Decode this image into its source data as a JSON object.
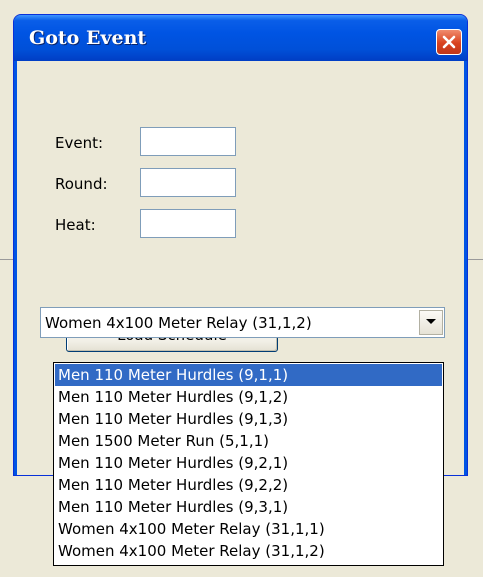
{
  "window": {
    "title": "Goto Event"
  },
  "form": {
    "event_label": "Event:",
    "round_label": "Round:",
    "heat_label": "Heat:",
    "event_value": "",
    "round_value": "",
    "heat_value": ""
  },
  "load_button": "Load Schedule",
  "combo": {
    "selected": "Women 4x100 Meter Relay (31,1,2)",
    "options": [
      "Men 110 Meter Hurdles (9,1,1)",
      "Men 110 Meter Hurdles (9,1,2)",
      "Men 110 Meter Hurdles (9,1,3)",
      "Men 1500 Meter Run (5,1,1)",
      "Men 110 Meter Hurdles (9,2,1)",
      "Men 110 Meter Hurdles (9,2,2)",
      "Men 110 Meter Hurdles (9,3,1)",
      "Women 4x100 Meter Relay (31,1,1)",
      "Women 4x100 Meter Relay (31,1,2)"
    ],
    "highlighted_index": 0
  },
  "icons": {
    "close": "close-icon",
    "dropdown": "chevron-down-icon"
  },
  "colors": {
    "title_bar": "#0054e3",
    "close_button": "#d9431f",
    "highlight": "#316ac5",
    "dialog_bg": "#ece9d8"
  }
}
